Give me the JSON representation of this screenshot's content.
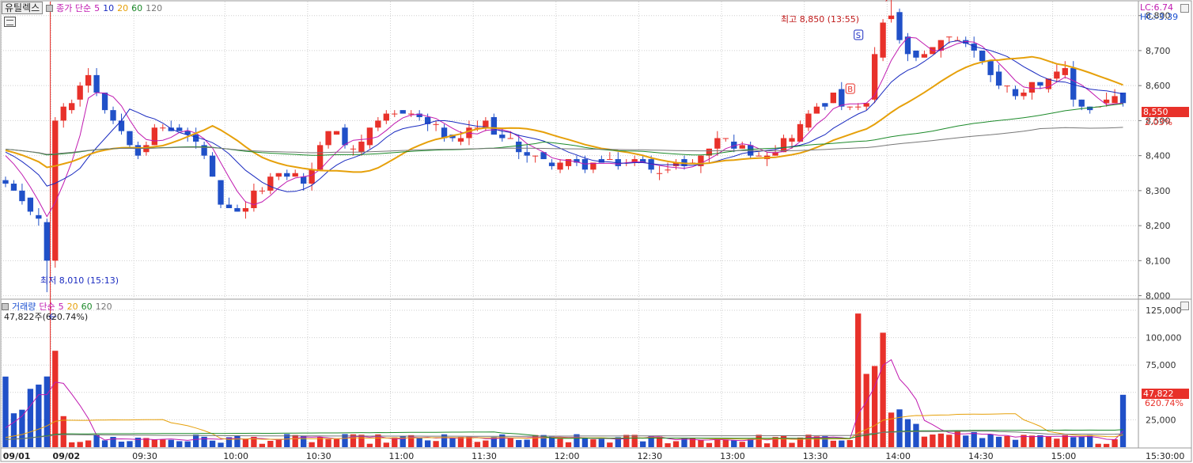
{
  "header": {
    "stock_name": "유틸렉스",
    "price_ma_label": "종가 단순",
    "price_ma_periods": [
      "5",
      "10",
      "20",
      "60",
      "120"
    ],
    "volume_label": "거래량",
    "volume_ma_label": "단순",
    "volume_ma_periods": [
      "5",
      "20",
      "60",
      "120"
    ],
    "volume_current": "47,822주(620.74%)"
  },
  "indicators": {
    "lc": "LC:6.74",
    "hc": "HC:-3.39"
  },
  "current": {
    "price": "8,550",
    "change": "2.03%",
    "volume": "47,822",
    "volume_pct": "620.74%"
  },
  "annotations": {
    "high": "최고 8,850 (13:55)",
    "low": "최저 8,010 (15:13)",
    "signal_s": "S",
    "signal_b": "B"
  },
  "colors": {
    "up": "#e8312a",
    "down": "#2050c8",
    "ma5": "#c01ab0",
    "ma10": "#1a2bc0",
    "ma20": "#e6a00a",
    "ma60": "#1c8a2a",
    "ma120": "#777777",
    "grid": "#cfcfcf"
  },
  "chart_data": [
    {
      "type": "candlestick",
      "title": "유틸렉스",
      "y_ticks": [
        "8,800",
        "8,700",
        "8,600",
        "8,500",
        "8,400",
        "8,300",
        "8,200",
        "8,100",
        "8,000"
      ],
      "ylim": [
        7990,
        8840
      ],
      "x_ticks": [
        "09/01",
        "09/02",
        "09:30",
        "10:00",
        "10:30",
        "11:00",
        "11:30",
        "12:00",
        "12:30",
        "13:00",
        "13:30",
        "14:00",
        "14:30",
        "15:00",
        "15:30:00"
      ],
      "x_tick_pos": [
        0,
        6,
        16,
        27,
        37,
        47,
        57,
        67,
        77,
        87,
        97,
        107,
        117,
        127,
        137
      ],
      "bars": 136,
      "high": 8850,
      "low": 8010,
      "last_close": 8550,
      "anchor_price": [
        [
          0,
          8320
        ],
        [
          2,
          8260
        ],
        [
          4,
          8230
        ],
        [
          5,
          8090
        ],
        [
          6,
          8500
        ],
        [
          8,
          8560
        ],
        [
          10,
          8640
        ],
        [
          12,
          8540
        ],
        [
          14,
          8470
        ],
        [
          16,
          8410
        ],
        [
          18,
          8470
        ],
        [
          20,
          8480
        ],
        [
          22,
          8460
        ],
        [
          24,
          8400
        ],
        [
          26,
          8250
        ],
        [
          28,
          8230
        ],
        [
          30,
          8290
        ],
        [
          32,
          8330
        ],
        [
          34,
          8350
        ],
        [
          36,
          8330
        ],
        [
          37,
          8350
        ],
        [
          38,
          8440
        ],
        [
          40,
          8470
        ],
        [
          42,
          8420
        ],
        [
          44,
          8470
        ],
        [
          46,
          8510
        ],
        [
          48,
          8530
        ],
        [
          50,
          8510
        ],
        [
          52,
          8480
        ],
        [
          54,
          8440
        ],
        [
          56,
          8470
        ],
        [
          58,
          8490
        ],
        [
          60,
          8450
        ],
        [
          62,
          8420
        ],
        [
          64,
          8390
        ],
        [
          66,
          8380
        ],
        [
          68,
          8380
        ],
        [
          70,
          8370
        ],
        [
          72,
          8380
        ],
        [
          74,
          8380
        ],
        [
          76,
          8380
        ],
        [
          78,
          8370
        ],
        [
          80,
          8360
        ],
        [
          82,
          8380
        ],
        [
          84,
          8390
        ],
        [
          86,
          8450
        ],
        [
          88,
          8430
        ],
        [
          90,
          8410
        ],
        [
          92,
          8410
        ],
        [
          94,
          8440
        ],
        [
          96,
          8490
        ],
        [
          98,
          8540
        ],
        [
          100,
          8570
        ],
        [
          102,
          8530
        ],
        [
          104,
          8550
        ],
        [
          105,
          8680
        ],
        [
          106,
          8780
        ],
        [
          107,
          8800
        ],
        [
          108,
          8720
        ],
        [
          109,
          8690
        ],
        [
          110,
          8670
        ],
        [
          112,
          8700
        ],
        [
          114,
          8750
        ],
        [
          116,
          8720
        ],
        [
          118,
          8680
        ],
        [
          120,
          8600
        ],
        [
          122,
          8580
        ],
        [
          124,
          8600
        ],
        [
          126,
          8620
        ],
        [
          128,
          8640
        ],
        [
          129,
          8560
        ],
        [
          131,
          8530
        ],
        [
          133,
          8560
        ],
        [
          135,
          8550
        ]
      ],
      "volume_ylim": [
        0,
        125000
      ],
      "volume_y_ticks": [
        "125,000",
        "100,000",
        "75,000",
        "50,000",
        "25,000"
      ],
      "current_volume": 47822
    }
  ]
}
